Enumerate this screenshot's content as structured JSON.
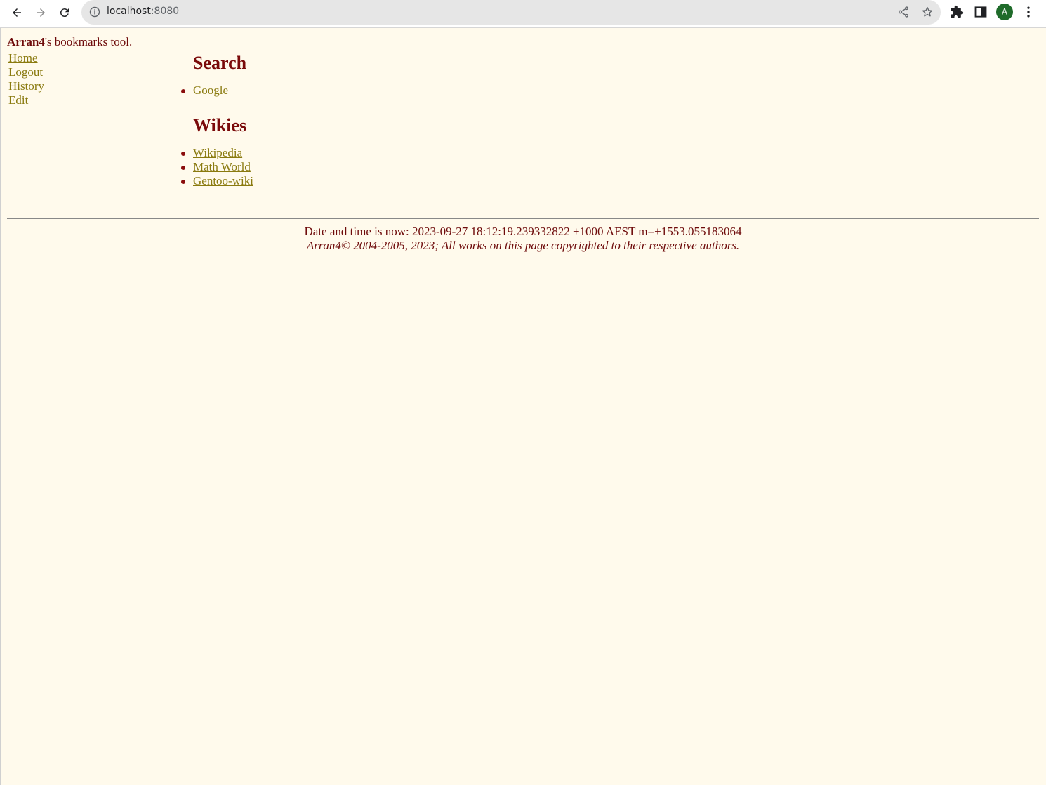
{
  "browser": {
    "url_host": "localhost",
    "url_port": ":8080",
    "profile_initial": "A"
  },
  "header": {
    "username": "Arran4",
    "tagline_rest": "'s bookmarks tool."
  },
  "sidebar": {
    "items": [
      {
        "label": "Home"
      },
      {
        "label": "Logout"
      },
      {
        "label": "History"
      },
      {
        "label": "Edit"
      }
    ]
  },
  "sections": [
    {
      "title": "Search",
      "links": [
        {
          "label": "Google"
        }
      ]
    },
    {
      "title": "Wikies",
      "links": [
        {
          "label": "Wikipedia"
        },
        {
          "label": "Math World"
        },
        {
          "label": "Gentoo-wiki"
        }
      ]
    }
  ],
  "footer": {
    "datetime": "Date and time is now: 2023-09-27 18:12:19.239332822 +1000 AEST m=+1553.055183064",
    "copyright": "Arran4© 2004-2005, 2023; All works on this page copyrighted to their respective authors."
  },
  "colors": {
    "background": "#fffaec",
    "text": "#6e0b0b",
    "link": "#8a7a0f",
    "heading": "#7a0a0a"
  },
  "icons": [
    "back-arrow-icon",
    "forward-arrow-icon",
    "reload-icon",
    "info-icon",
    "share-icon",
    "star-icon",
    "extensions-puzzle-icon",
    "side-panel-icon",
    "kebab-menu-icon"
  ]
}
